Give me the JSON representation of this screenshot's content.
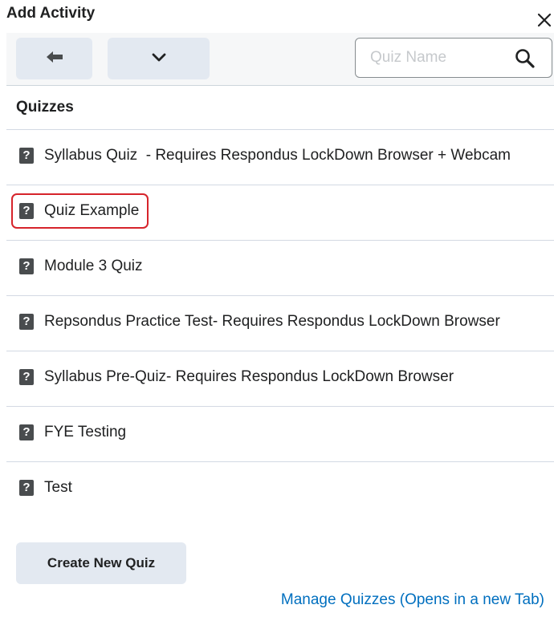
{
  "dialog": {
    "title": "Add Activity",
    "close_icon": "close-icon"
  },
  "toolbar": {
    "back_icon": "arrow-left-icon",
    "more_icon": "chevron-down-icon",
    "search": {
      "placeholder": "Quiz Name",
      "value": "",
      "icon": "search-icon"
    }
  },
  "list": {
    "header": "Quizzes",
    "item_icon": "quiz-question-icon",
    "items": [
      {
        "label": "Syllabus Quiz  - Requires Respondus LockDown Browser + Webcam"
      },
      {
        "label": "Quiz Example"
      },
      {
        "label": "Module 3 Quiz"
      },
      {
        "label": "Repsondus Practice Test- Requires Respondus LockDown Browser"
      },
      {
        "label": "Syllabus Pre-Quiz- Requires Respondus LockDown Browser"
      },
      {
        "label": "FYE Testing"
      },
      {
        "label": "Test"
      }
    ],
    "highlighted_item": "Quiz Example",
    "highlight_color": "#d6242b"
  },
  "actions": {
    "create_label": "Create New Quiz",
    "manage_link": "Manage Quizzes (Opens in a new Tab)"
  },
  "colors": {
    "button_bg": "#e3e9f1",
    "link": "#006fbf",
    "icon": "#494c4e"
  }
}
